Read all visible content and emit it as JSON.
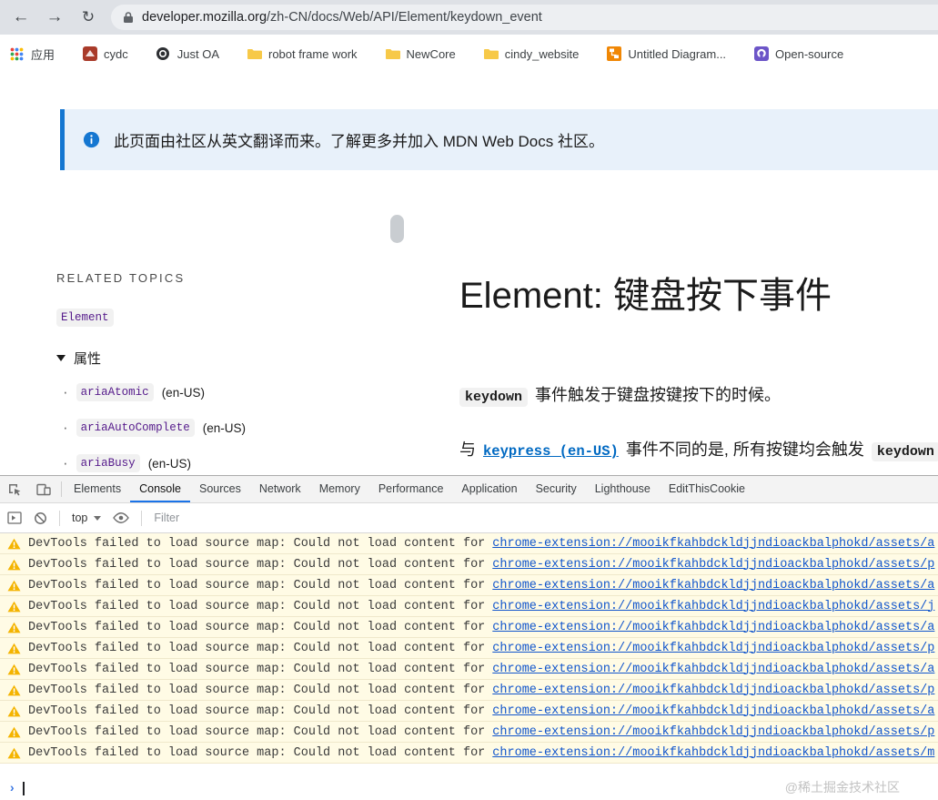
{
  "browser": {
    "nav": {
      "back": "←",
      "forward": "→",
      "reload": "↻"
    },
    "url": {
      "host": "developer.mozilla.org",
      "path": "/zh-CN/docs/Web/API/Element/keydown_event"
    },
    "bookmarks": [
      {
        "label": "应用",
        "icon": "apps-grid-icon"
      },
      {
        "label": "cydc",
        "icon": "cydc-logo-icon"
      },
      {
        "label": "Just OA",
        "icon": "justoa-logo-icon"
      },
      {
        "label": "robot frame work",
        "icon": "folder-icon"
      },
      {
        "label": "NewCore",
        "icon": "folder-icon"
      },
      {
        "label": "cindy_website",
        "icon": "folder-icon"
      },
      {
        "label": "Untitled Diagram...",
        "icon": "drawio-logo-icon"
      },
      {
        "label": "Open-source",
        "icon": "opensource-logo-icon"
      }
    ]
  },
  "banner": {
    "text": "此页面由社区从英文翻译而来。了解更多并加入 MDN Web Docs 社区。"
  },
  "sidebar": {
    "heading": "RELATED TOPICS",
    "top_link": "Element",
    "group_label": "属性",
    "items": [
      {
        "code": "ariaAtomic",
        "suffix": "(en-US)"
      },
      {
        "code": "ariaAutoComplete",
        "suffix": "(en-US)"
      },
      {
        "code": "ariaBusy",
        "suffix": "(en-US)"
      }
    ]
  },
  "article": {
    "title": "Element: 键盘按下事件",
    "intro_code": "keydown",
    "intro_text": "事件触发于键盘按键按下的时候。",
    "para2": {
      "prefix": "与",
      "link": "keypress (en-US)",
      "middle": "事件不同的是, 所有按键均会触发",
      "code": "keydown"
    }
  },
  "devtools": {
    "tabs": [
      "Elements",
      "Console",
      "Sources",
      "Network",
      "Memory",
      "Performance",
      "Application",
      "Security",
      "Lighthouse",
      "EditThisCookie"
    ],
    "active_tab": "Console",
    "toolbar": {
      "context": "top",
      "filter_placeholder": "Filter"
    },
    "console": {
      "warning_prefix": "DevTools failed to load source map: Could not load content for ",
      "prompt": "›",
      "links": [
        "chrome-extension://mooikfkahbdckldjjndioackbalphokd/assets/a",
        "chrome-extension://mooikfkahbdckldjjndioackbalphokd/assets/p",
        "chrome-extension://mooikfkahbdckldjjndioackbalphokd/assets/a",
        "chrome-extension://mooikfkahbdckldjjndioackbalphokd/assets/j",
        "chrome-extension://mooikfkahbdckldjjndioackbalphokd/assets/a",
        "chrome-extension://mooikfkahbdckldjjndioackbalphokd/assets/p",
        "chrome-extension://mooikfkahbdckldjjndioackbalphokd/assets/a",
        "chrome-extension://mooikfkahbdckldjjndioackbalphokd/assets/p",
        "chrome-extension://mooikfkahbdckldjjndioackbalphokd/assets/a",
        "chrome-extension://mooikfkahbdckldjjndioackbalphokd/assets/p",
        "chrome-extension://mooikfkahbdckldjjndioackbalphokd/assets/m"
      ]
    },
    "watermark": "@稀土掘金技术社区"
  },
  "colors": {
    "banner_accent": "#1577d1",
    "devtools_tab_active": "#1a73e8",
    "warning_bg": "#fffbe5",
    "console_link": "#1155cc",
    "mdn_link": "#0069c2",
    "visited_link": "#551a8b"
  }
}
